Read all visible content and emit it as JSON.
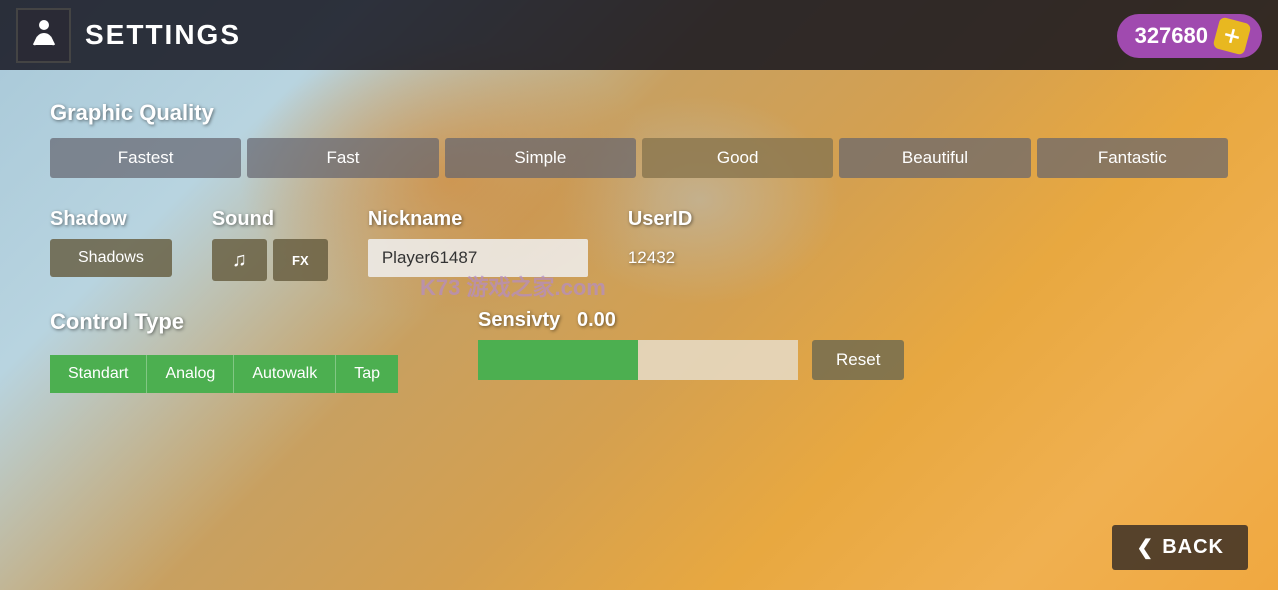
{
  "header": {
    "title": "SETTINGS"
  },
  "currency": {
    "amount": "327680",
    "icon_symbol": "+"
  },
  "graphic_quality": {
    "label": "Graphic Quality",
    "buttons": [
      {
        "label": "Fastest",
        "active": false
      },
      {
        "label": "Fast",
        "active": false
      },
      {
        "label": "Simple",
        "active": false
      },
      {
        "label": "Good",
        "active": true
      },
      {
        "label": "Beautiful",
        "active": false
      },
      {
        "label": "Fantastic",
        "active": false
      }
    ]
  },
  "shadow": {
    "label": "Shadow",
    "button_label": "Shadows"
  },
  "sound": {
    "label": "Sound",
    "music_icon": "♫",
    "fx_icon": "FX"
  },
  "nickname": {
    "label": "Nickname",
    "value": "Player61487",
    "placeholder": "Nickname"
  },
  "userid": {
    "label": "UserID",
    "value": "12432"
  },
  "watermark": {
    "text": "K73 游戏之家.com"
  },
  "control_type": {
    "label": "Control Type",
    "buttons": [
      {
        "label": "Standart"
      },
      {
        "label": "Analog"
      },
      {
        "label": "Autowalk"
      },
      {
        "label": "Tap"
      }
    ]
  },
  "sensitivity": {
    "label": "Sensivty",
    "value": "0.00",
    "reset_label": "Reset"
  },
  "back_button": {
    "label": "BACK",
    "chevron": "❮"
  }
}
